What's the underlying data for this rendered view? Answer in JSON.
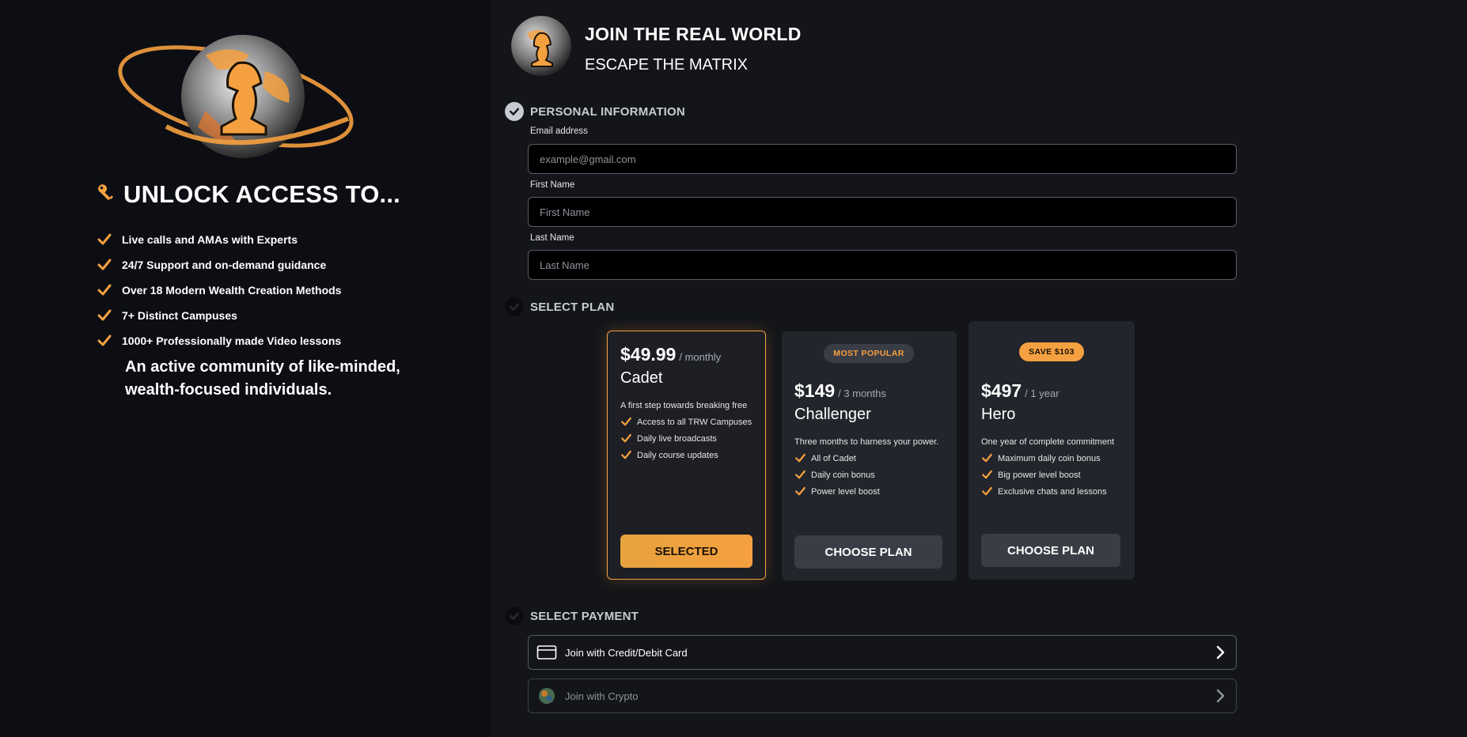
{
  "left": {
    "unlock_title": "UNLOCK ACCESS TO...",
    "features": [
      "Live calls and AMAs with Experts",
      "24/7 Support and on-demand guidance",
      "Over 18 Modern Wealth Creation Methods",
      "7+ Distinct Campuses",
      "1000+ Professionally made Video lessons"
    ],
    "community": "An active community of like-minded, wealth-focused individuals."
  },
  "header": {
    "title": "JOIN THE REAL WORLD",
    "subtitle": "ESCAPE THE MATRIX"
  },
  "personal": {
    "heading": "PERSONAL INFORMATION",
    "email_label": "Email address",
    "email_placeholder": "example@gmail.com",
    "first_label": "First Name",
    "first_placeholder": "First Name",
    "last_label": "Last Name",
    "last_placeholder": "Last Name"
  },
  "plans": {
    "heading": "SELECT PLAN",
    "items": [
      {
        "price": "$49.99",
        "period": "/ monthly",
        "name": "Cadet",
        "desc": "A first step towards breaking free",
        "features": [
          "Access to all TRW Campuses",
          "Daily live broadcasts",
          "Daily course updates"
        ],
        "button": "SELECTED"
      },
      {
        "badge": "MOST POPULAR",
        "price": "$149",
        "period": "/ 3 months",
        "name": "Challenger",
        "desc": "Three months to harness your power.",
        "features": [
          "All of Cadet",
          "Daily coin bonus",
          "Power level boost"
        ],
        "button": "CHOOSE PLAN"
      },
      {
        "badge": "SAVE $103",
        "price": "$497",
        "period": "/ 1 year",
        "name": "Hero",
        "desc": "One year of complete commitment",
        "features": [
          "Maximum daily coin bonus",
          "Big power level boost",
          "Exclusive chats and lessons"
        ],
        "button": "CHOOSE PLAN"
      }
    ]
  },
  "payment": {
    "heading": "SELECT PAYMENT",
    "card": "Join with Credit/Debit Card",
    "crypto": "Join with Crypto"
  },
  "colors": {
    "accent": "#f5a040",
    "panel_left": "#0c0e13",
    "panel_right": "#131519",
    "card": "#22252b"
  }
}
